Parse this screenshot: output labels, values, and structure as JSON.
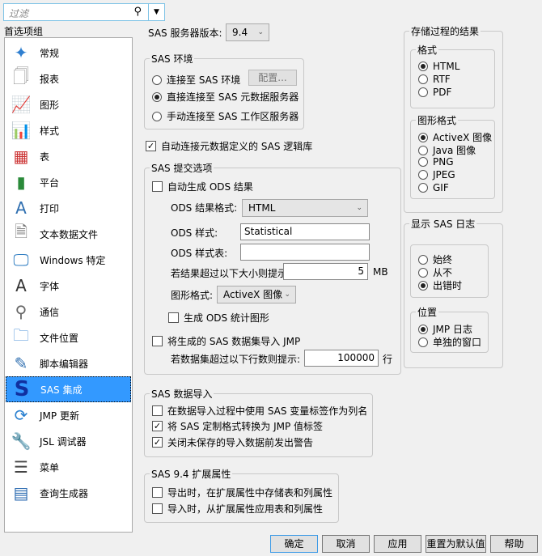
{
  "filter": {
    "placeholder": "过滤"
  },
  "sidebar": {
    "title": "首选项组",
    "items": [
      {
        "label": "常规",
        "icon": "jmp-person-icon"
      },
      {
        "label": "报表",
        "icon": "report-icon"
      },
      {
        "label": "图形",
        "icon": "graph-icon"
      },
      {
        "label": "样式",
        "icon": "style-icon"
      },
      {
        "label": "表",
        "icon": "table-icon"
      },
      {
        "label": "平台",
        "icon": "platform-icon"
      },
      {
        "label": "打印",
        "icon": "print-icon"
      },
      {
        "label": "文本数据文件",
        "icon": "txt-file-icon"
      },
      {
        "label": "Windows 特定",
        "icon": "monitor-icon"
      },
      {
        "label": "字体",
        "icon": "font-icon"
      },
      {
        "label": "通信",
        "icon": "communication-icon"
      },
      {
        "label": "文件位置",
        "icon": "folder-icon"
      },
      {
        "label": "脚本编辑器",
        "icon": "script-editor-icon"
      },
      {
        "label": "SAS 集成",
        "icon": "sas-icon"
      },
      {
        "label": "JMP 更新",
        "icon": "update-icon"
      },
      {
        "label": "JSL 调试器",
        "icon": "debugger-icon"
      },
      {
        "label": "菜单",
        "icon": "menu-icon"
      },
      {
        "label": "查询生成器",
        "icon": "query-builder-icon"
      }
    ],
    "selected": "SAS 集成"
  },
  "server": {
    "label": "SAS 服务器版本:",
    "value": "9.4"
  },
  "env": {
    "title": "SAS 环境",
    "opt1": "连接至 SAS 环境",
    "config": "配置...",
    "opt2": "直接连接至 SAS 元数据服务器",
    "opt3": "手动连接至 SAS 工作区服务器"
  },
  "autoconnect": "自动连接元数据定义的 SAS 逻辑库",
  "submit": {
    "title": "SAS 提交选项",
    "auto_ods": "自动生成 ODS 结果",
    "ods_format_label": "ODS 结果格式:",
    "ods_format": "HTML",
    "ods_style_label": "ODS 样式:",
    "ods_style": "Statistical",
    "ods_sheet_label": "ODS 样式表:",
    "ods_sheet": "",
    "size_label": "若结果超过以下大小则提示:",
    "size": "5",
    "size_unit": "MB",
    "graph_label": "图形格式:",
    "graph": "ActiveX 图像",
    "ods_stat": "生成 ODS 统计图形",
    "import_ds": "将生成的 SAS 数据集导入 JMP",
    "rows_label": "若数据集超过以下行数则提示:",
    "rows": "100000",
    "rows_unit": "行"
  },
  "import": {
    "title": "SAS 数据导入",
    "opt1": "在数据导入过程中使用 SAS 变量标签作为列名",
    "opt2": "将 SAS 定制格式转换为 JMP 值标签",
    "opt3": "关闭未保存的导入数据前发出警告"
  },
  "ext": {
    "title": "SAS 9.4 扩展属性",
    "opt1": "导出时，在扩展属性中存储表和列属性",
    "opt2": "导入时，从扩展属性应用表和列属性"
  },
  "stored": {
    "title": "存储过程的结果",
    "format_title": "格式",
    "formats": [
      "HTML",
      "RTF",
      "PDF"
    ],
    "graph_title": "图形格式",
    "graphs": [
      "ActiveX 图像",
      "Java 图像",
      "PNG",
      "JPEG",
      "GIF"
    ]
  },
  "log": {
    "title": "显示 SAS 日志",
    "show": [
      "始终",
      "从不",
      "出错时"
    ],
    "pos_title": "位置",
    "pos": [
      "JMP 日志",
      "单独的窗口"
    ]
  },
  "buttons": {
    "ok": "确定",
    "cancel": "取消",
    "apply": "应用",
    "reset": "重置为默认值",
    "help": "帮助"
  }
}
